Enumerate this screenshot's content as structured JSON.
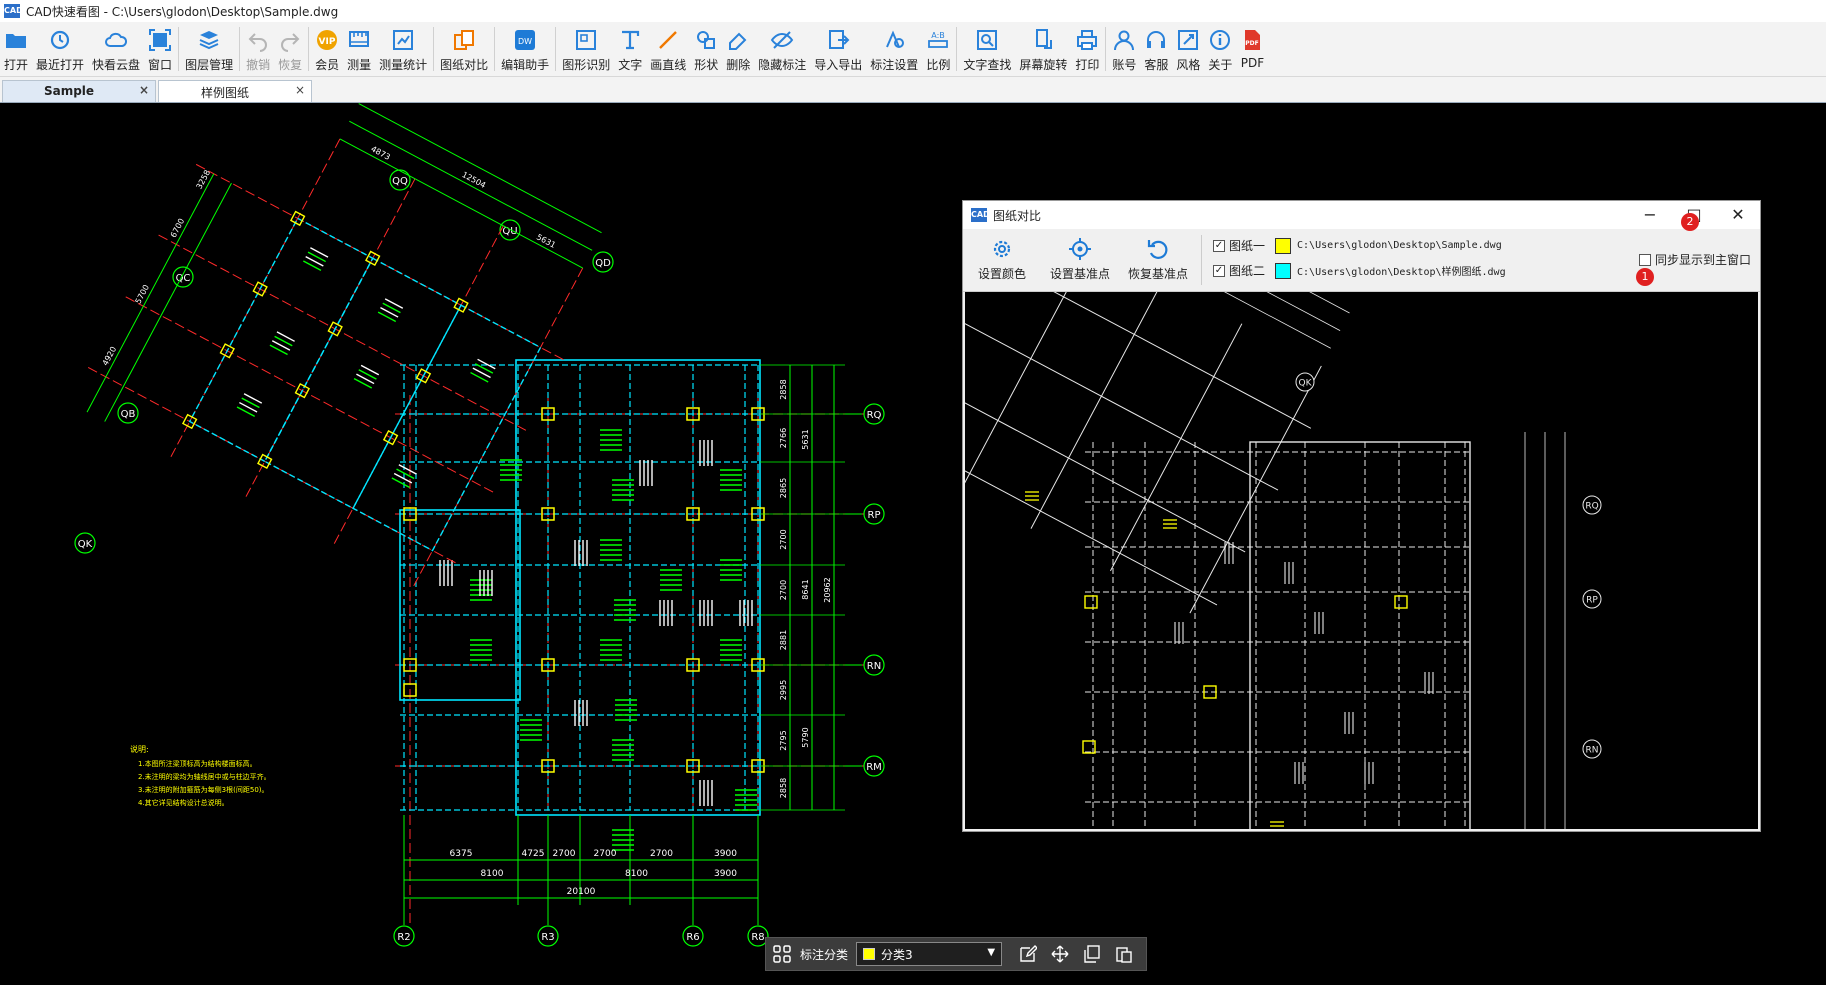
{
  "window": {
    "title": "CAD快速看图 - C:\\Users\\glodon\\Desktop\\Sample.dwg",
    "icon_text": "CAD"
  },
  "toolbar": [
    {
      "key": "open",
      "label": "打开",
      "icon": "folder-icon",
      "enabled": true
    },
    {
      "key": "recent",
      "label": "最近打开",
      "icon": "history-icon",
      "enabled": true
    },
    {
      "key": "cloud",
      "label": "快看云盘",
      "icon": "cloud-icon",
      "enabled": true
    },
    {
      "key": "window",
      "label": "窗口",
      "icon": "window-icon",
      "enabled": true
    },
    {
      "key": "layers",
      "label": "图层管理",
      "icon": "layers-icon",
      "enabled": true
    },
    {
      "key": "undo",
      "label": "撤销",
      "icon": "undo-icon",
      "enabled": false
    },
    {
      "key": "redo",
      "label": "恢复",
      "icon": "redo-icon",
      "enabled": false
    },
    {
      "key": "vip",
      "label": "会员",
      "icon": "vip-icon",
      "enabled": true
    },
    {
      "key": "measure",
      "label": "测量",
      "icon": "ruler-icon",
      "enabled": true
    },
    {
      "key": "measure_stats",
      "label": "测量统计",
      "icon": "stats-icon",
      "enabled": true
    },
    {
      "key": "compare",
      "label": "图纸对比",
      "icon": "compare-icon",
      "enabled": true
    },
    {
      "key": "edit_helper",
      "label": "编辑助手",
      "icon": "edit-helper-icon",
      "enabled": true
    },
    {
      "key": "shape_recog",
      "label": "图形识别",
      "icon": "shape-recognition-icon",
      "enabled": true
    },
    {
      "key": "text",
      "label": "文字",
      "icon": "text-icon",
      "enabled": true
    },
    {
      "key": "line",
      "label": "画直线",
      "icon": "line-icon",
      "enabled": true
    },
    {
      "key": "shape",
      "label": "形状",
      "icon": "shape-icon",
      "enabled": true
    },
    {
      "key": "delete",
      "label": "删除",
      "icon": "eraser-icon",
      "enabled": true
    },
    {
      "key": "hide_mark",
      "label": "隐藏标注",
      "icon": "eye-slash-icon",
      "enabled": true
    },
    {
      "key": "import_export",
      "label": "导入导出",
      "icon": "import-export-icon",
      "enabled": true
    },
    {
      "key": "mark_settings",
      "label": "标注设置",
      "icon": "mark-settings-icon",
      "enabled": true
    },
    {
      "key": "scale",
      "label": "比例",
      "icon": "scale-icon",
      "enabled": true
    },
    {
      "key": "text_search",
      "label": "文字查找",
      "icon": "text-search-icon",
      "enabled": true
    },
    {
      "key": "rotate",
      "label": "屏幕旋转",
      "icon": "rotate-screen-icon",
      "enabled": true
    },
    {
      "key": "print",
      "label": "打印",
      "icon": "printer-icon",
      "enabled": true
    },
    {
      "key": "account",
      "label": "账号",
      "icon": "user-icon",
      "enabled": true
    },
    {
      "key": "service",
      "label": "客服",
      "icon": "headset-icon",
      "enabled": true
    },
    {
      "key": "style",
      "label": "风格",
      "icon": "style-icon",
      "enabled": true
    },
    {
      "key": "about",
      "label": "关于",
      "icon": "info-icon",
      "enabled": true
    },
    {
      "key": "pdf",
      "label": "PDF",
      "icon": "pdf-icon",
      "enabled": true
    }
  ],
  "tabs": [
    {
      "label": "Sample",
      "active": true,
      "close": "×"
    },
    {
      "label": "样例图纸",
      "active": false,
      "close": "×"
    }
  ],
  "axes_main": {
    "bottom": [
      "R2",
      "R3",
      "R6",
      "R8"
    ],
    "right": [
      "RQ",
      "RP",
      "RN",
      "RM"
    ],
    "rotated": [
      "QQ",
      "QU",
      "QD",
      "QC",
      "QB",
      "QK"
    ]
  },
  "dims_main": {
    "bottom_row1": [
      "6375",
      "4725",
      "2700",
      "2700",
      "2700",
      "3900"
    ],
    "bottom_row2": [
      "8100",
      "8100",
      "3900"
    ],
    "bottom_total": "20100",
    "right_row1": [
      "2858",
      "2766",
      "2865",
      "2700",
      "2700",
      "2881",
      "2995",
      "2795",
      "2858"
    ],
    "right_row2": [
      "5631",
      "8641",
      "5790"
    ],
    "right_total": "20962",
    "rotated_top": [
      "4873",
      "12504",
      "5631"
    ],
    "rotated_left": [
      "3258",
      "6700",
      "5700",
      "4920"
    ]
  },
  "notes": {
    "title": "说明:",
    "lines": [
      "1.本图所注梁顶标高为结构楼面标高。",
      "2.未注明的梁均为轴线居中或与柱边平齐。",
      "3.未注明的附加箍筋为每侧3根(间距50)。",
      "4.其它详见结构设计总说明。"
    ]
  },
  "compare_window": {
    "title": "图纸对比",
    "controls": {
      "minimize": "−",
      "maximize": "□",
      "close": "✕"
    },
    "buttons": [
      {
        "label": "设置颜色",
        "icon": "gear-icon"
      },
      {
        "label": "设置基准点",
        "icon": "crosshair-icon"
      },
      {
        "label": "恢复基准点",
        "icon": "reset-icon"
      }
    ],
    "files": [
      {
        "label": "图纸一",
        "checked": true,
        "color": "#ffff00",
        "path": "C:\\Users\\glodon\\Desktop\\Sample.dwg"
      },
      {
        "label": "图纸二",
        "checked": true,
        "color": "#00ffff",
        "path": "C:\\Users\\glodon\\Desktop\\样例图纸.dwg"
      }
    ],
    "sync_label": "同步显示到主窗口",
    "sync_checked": false,
    "badges": [
      "1",
      "2"
    ],
    "axes": [
      "RQ",
      "RP",
      "RN",
      "QK"
    ]
  },
  "bottom_bar": {
    "label": "标注分类",
    "selected": "分类3",
    "swatch_color": "#ffff00",
    "icons": [
      "grid-icon",
      "edit-icon",
      "move-icon",
      "copy-icon",
      "paste-icon"
    ]
  }
}
